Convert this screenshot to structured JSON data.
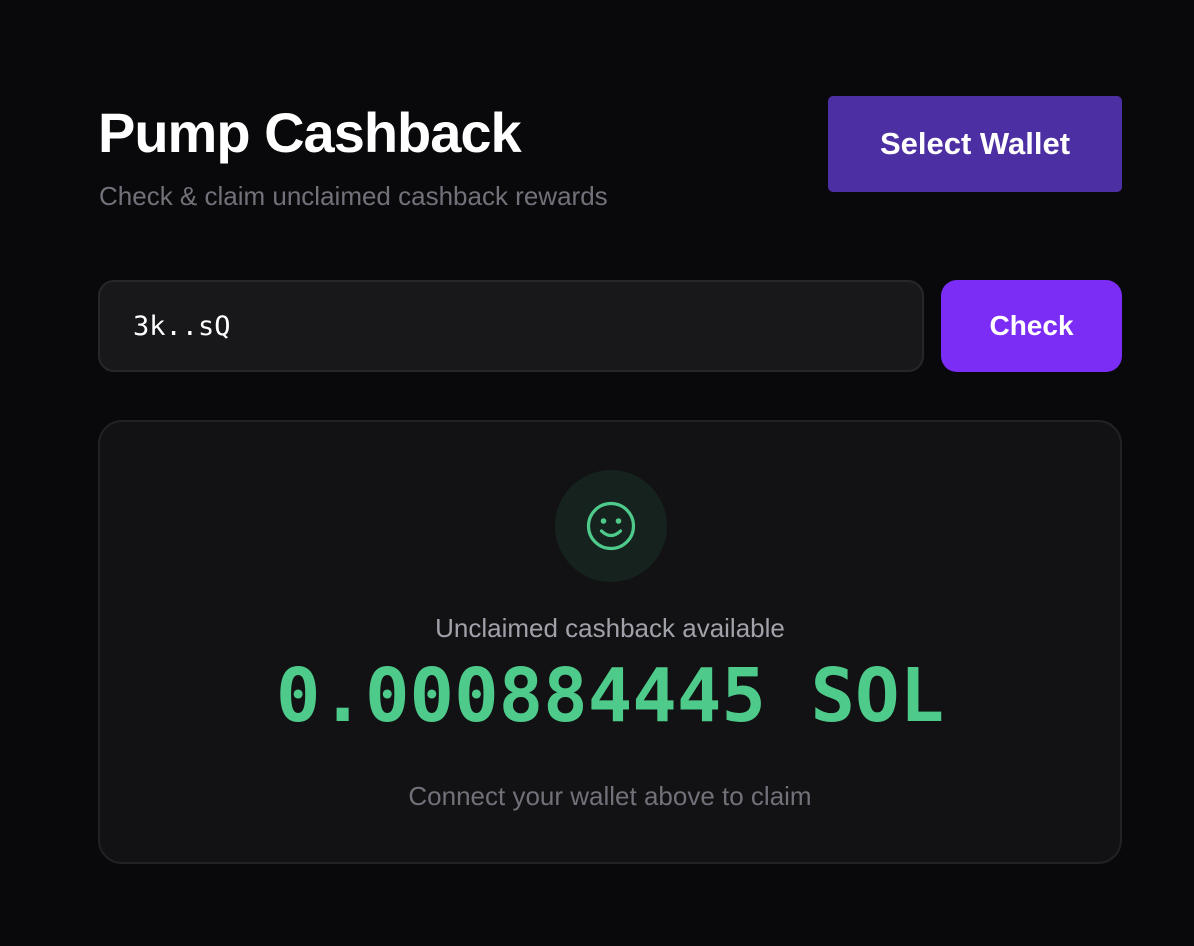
{
  "header": {
    "title": "Pump Cashback",
    "subtitle": "Check & claim unclaimed cashback rewards"
  },
  "wallet": {
    "button_label": "Select Wallet"
  },
  "lookup": {
    "address_value": "3k..sQ",
    "check_label": "Check"
  },
  "result": {
    "icon": "smiley-icon",
    "label": "Unclaimed cashback available",
    "amount": "0.000884445 SOL",
    "note": "Connect your wallet above to claim"
  },
  "colors": {
    "background": "#09090b",
    "wallet_button": "#4c2fa3",
    "check_button": "#7b2cf5",
    "success": "#4ecb8b",
    "muted_text": "#71717a"
  }
}
